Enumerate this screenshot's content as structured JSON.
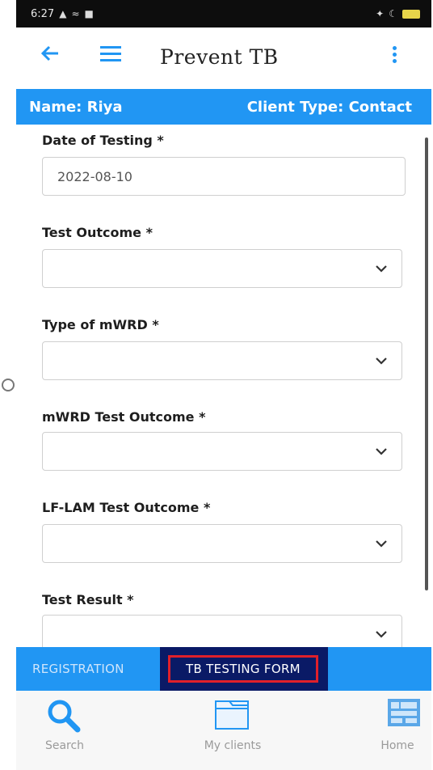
{
  "status_bar": {
    "time": "6:27"
  },
  "app_bar": {
    "title": "Prevent TB"
  },
  "client": {
    "name_label": "Name: Riya",
    "type_label": "Client Type: Contact"
  },
  "form": {
    "date_of_testing": {
      "label": "Date of Testing *",
      "value": "2022-08-10"
    },
    "test_outcome": {
      "label": "Test Outcome *",
      "value": ""
    },
    "type_of_mwrd": {
      "label": "Type of mWRD *",
      "value": ""
    },
    "mwrd_test_outcome": {
      "label": "mWRD Test Outcome *",
      "value": ""
    },
    "lf_lam_test_outcome": {
      "label": "LF-LAM Test Outcome *",
      "value": ""
    },
    "test_result": {
      "label": "Test Result *",
      "value": ""
    }
  },
  "tabs": {
    "registration": "REGISTRATION",
    "tb_testing_form": "TB TESTING FORM",
    "active": "TB TESTING FORM"
  },
  "bottom_nav": {
    "search": "Search",
    "my_clients": "My clients",
    "home": "Home"
  },
  "colors": {
    "primary": "#2196f3",
    "active_tab_bg": "#0a1a66",
    "highlight_border": "#e0202a"
  }
}
